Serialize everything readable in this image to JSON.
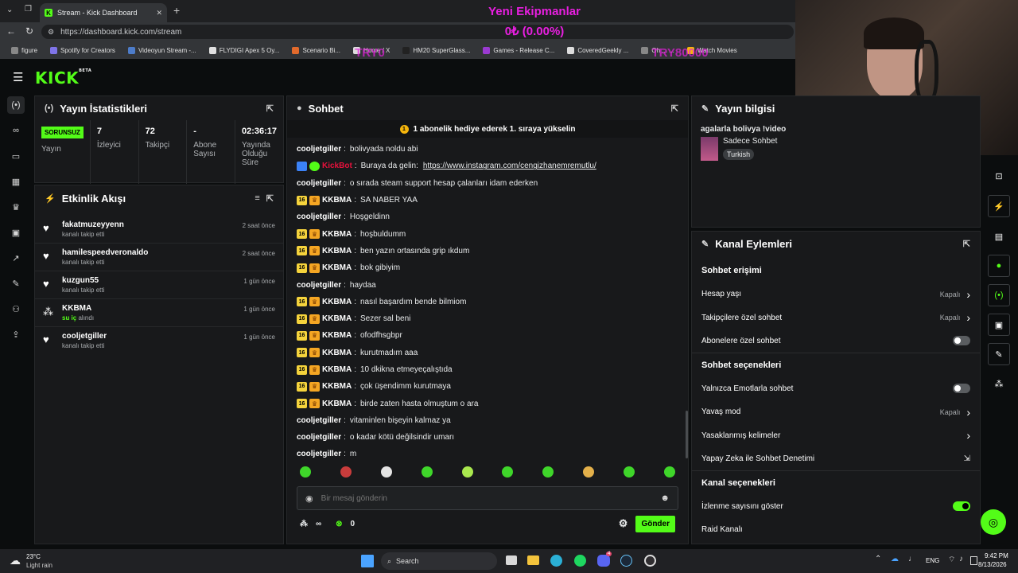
{
  "browser": {
    "tab_title": "Stream - Kick Dashboard",
    "url": "https://dashboard.kick.com/stream",
    "bookmarks": [
      "figure",
      "Spotify for Creators",
      "Videoyun Stream -...",
      "FLYDIGI Apex 5 Oy...",
      "Scenario Bi...",
      "Home / X",
      "HM20 SuperGlass...",
      "Games - Release C...",
      "CoveredGeekly ...",
      "Oh ... ...",
      "Watch Movies"
    ]
  },
  "overlay": {
    "title": "Yeni Ekipmanlar",
    "amount": "0₺ (0.00%)",
    "left_value": "TRY0",
    "right_value": "TRY80000"
  },
  "stats_panel": {
    "title": "Yayın İstatistikleri",
    "status_badge": "SORUNSUZ",
    "items": [
      {
        "value": "",
        "label": "Yayın"
      },
      {
        "value": "7",
        "label": "İzleyici"
      },
      {
        "value": "72",
        "label": "Takipçi"
      },
      {
        "value": "-",
        "label": "Abone Sayısı"
      },
      {
        "value": "02:36:17",
        "label": "Yayında Olduğu Süre"
      }
    ]
  },
  "activity": {
    "title": "Etkinlik Akışı",
    "items": [
      {
        "name": "fakatmuzeyyenn",
        "sub": "kanalı takip etti",
        "time": "2 saat önce"
      },
      {
        "name": "hamilespeedveronaldo",
        "sub": "kanalı takip etti",
        "time": "2 saat önce"
      },
      {
        "name": "kuzgun55",
        "sub": "kanalı takip etti",
        "time": "1 gün önce"
      },
      {
        "name": "KKBMA",
        "sub_a": "su iç",
        "sub_b": "alındı",
        "time": "1 gün önce"
      },
      {
        "name": "cooljetgiller",
        "sub": "kanalı takip etti",
        "time": "1 gün önce"
      }
    ]
  },
  "chat": {
    "title": "Sohbet",
    "pinned": "1 abonelik hediye ederek 1. sıraya yükselin",
    "sub_badge": "16",
    "messages": [
      {
        "user": "cooljetgiller",
        "text": "bolivyada noldu abi",
        "badges": false
      },
      {
        "user": "KickBot",
        "text": "Buraya da gelin:",
        "link": "https://www.instagram.com/cengizhanemremutlu/",
        "bot": true
      },
      {
        "user": "cooljetgiller",
        "text": "o sırada steam support hesap çalanları idam ederken",
        "badges": false
      },
      {
        "user": "KKBMA",
        "text": "SA NABER YAA",
        "badges": true
      },
      {
        "user": "cooljetgiller",
        "text": "Hoşgeldinn",
        "badges": false
      },
      {
        "user": "KKBMA",
        "text": "hoşbuldumm",
        "badges": true
      },
      {
        "user": "KKBMA",
        "text": "ben yazın ortasında grip ıkdum",
        "badges": true
      },
      {
        "user": "KKBMA",
        "text": "bok gibiyim",
        "badges": true
      },
      {
        "user": "cooljetgiller",
        "text": "haydaa",
        "badges": false
      },
      {
        "user": "KKBMA",
        "text": "nasıl başardım bende bilmiom",
        "badges": true
      },
      {
        "user": "KKBMA",
        "text": "Sezer sal beni",
        "badges": true
      },
      {
        "user": "KKBMA",
        "text": "ofodfhsgbpr",
        "badges": true
      },
      {
        "user": "KKBMA",
        "text": "kurutmadım aaa",
        "badges": true
      },
      {
        "user": "KKBMA",
        "text": "10 dkikna etmeyeçalıştıda",
        "badges": true
      },
      {
        "user": "KKBMA",
        "text": "çok üşendimm kurutmaya",
        "badges": true
      },
      {
        "user": "KKBMA",
        "text": "birde zaten hasta olmuştum o ara",
        "badges": true
      },
      {
        "user": "cooljetgiller",
        "text": "vitaminlen bişeyin kalmaz ya",
        "badges": false
      },
      {
        "user": "cooljetgiller",
        "text": "o kadar kötü değilsindir umarı",
        "badges": false
      },
      {
        "user": "cooljetgiller",
        "text": "m",
        "badges": false
      }
    ],
    "input_placeholder": "Bir mesaj gönderin",
    "points": "∞",
    "coins": "0",
    "send_label": "Gönder"
  },
  "stream_info": {
    "title": "Yayın bilgisi",
    "stream_title": "agalarla bolivya !video",
    "category": "Sadece Sohbet",
    "language": "Turkish"
  },
  "channel_actions": {
    "title": "Kanal Eylemleri",
    "sections": [
      {
        "heading": "Sohbet erişimi",
        "rows": [
          {
            "label": "Hesap yaşı",
            "value": "Kapalı",
            "kind": "chevron"
          },
          {
            "label": "Takipçilere özel sohbet",
            "value": "Kapalı",
            "kind": "chevron"
          },
          {
            "label": "Abonelere özel sohbet",
            "value": "",
            "kind": "toggle-off"
          }
        ]
      },
      {
        "heading": "Sohbet seçenekleri",
        "rows": [
          {
            "label": "Yalnızca Emotlarla sohbet",
            "value": "",
            "kind": "toggle-off"
          },
          {
            "label": "Yavaş mod",
            "value": "Kapalı",
            "kind": "chevron"
          },
          {
            "label": "Yasaklanmış kelimeler",
            "value": "",
            "kind": "chevron"
          },
          {
            "label": "Yapay Zeka ile Sohbet Denetimi",
            "value": "",
            "kind": "external"
          }
        ]
      },
      {
        "heading": "Kanal seçenekleri",
        "rows": [
          {
            "label": "İzlenme sayısını göster",
            "value": "",
            "kind": "toggle-on"
          },
          {
            "label": "Raid Kanalı",
            "value": "",
            "kind": "none"
          }
        ]
      }
    ]
  },
  "taskbar": {
    "weather_temp": "23°C",
    "weather_desc": "Light rain",
    "search": "Search",
    "lang": "ENG",
    "time": "9:42 PM",
    "date": "8/13/2026",
    "notif_count": "4"
  },
  "colors": {
    "accent": "#53fc18",
    "overlay": "#e81fe0",
    "panel": "#18191b",
    "background": "#0b0d0e"
  }
}
